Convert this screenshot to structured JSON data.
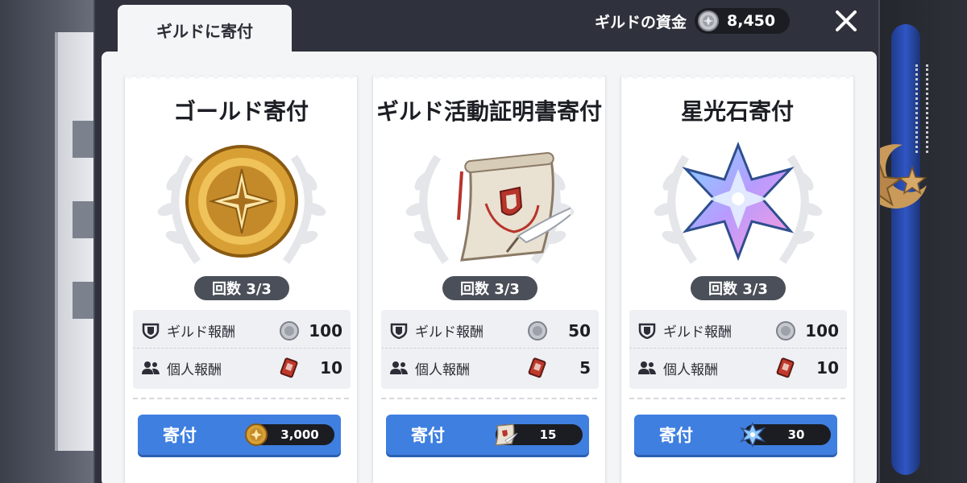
{
  "tab": {
    "label": "ギルドに寄付"
  },
  "funds": {
    "label": "ギルドの資金",
    "value": "8,450",
    "icon": "silver-coin-icon"
  },
  "close": {
    "icon": "close-icon"
  },
  "colors": {
    "accent": "#3f7fe0",
    "panel": "#f4f5f7",
    "dark": "#1b1d22"
  },
  "cards": [
    {
      "title": "ゴールド寄付",
      "item_icon": "gold-coin-icon",
      "count": "回数 3/3",
      "guild_reward_label": "ギルド報酬",
      "guild_reward_value": "100",
      "personal_reward_label": "個人報酬",
      "personal_reward_value": "10",
      "button_label": "寄付",
      "cost": "3,000",
      "cost_icon": "gold-coin-icon"
    },
    {
      "title": "ギルド活動証明書寄付",
      "item_icon": "certificate-scroll-icon",
      "count": "回数 3/3",
      "guild_reward_label": "ギルド報酬",
      "guild_reward_value": "50",
      "personal_reward_label": "個人報酬",
      "personal_reward_value": "5",
      "button_label": "寄付",
      "cost": "15",
      "cost_icon": "certificate-scroll-icon"
    },
    {
      "title": "星光石寄付",
      "item_icon": "starlight-crystal-icon",
      "count": "回数 3/3",
      "guild_reward_label": "ギルド報酬",
      "guild_reward_value": "100",
      "personal_reward_label": "個人報酬",
      "personal_reward_value": "10",
      "button_label": "寄付",
      "cost": "30",
      "cost_icon": "starlight-crystal-icon"
    }
  ]
}
